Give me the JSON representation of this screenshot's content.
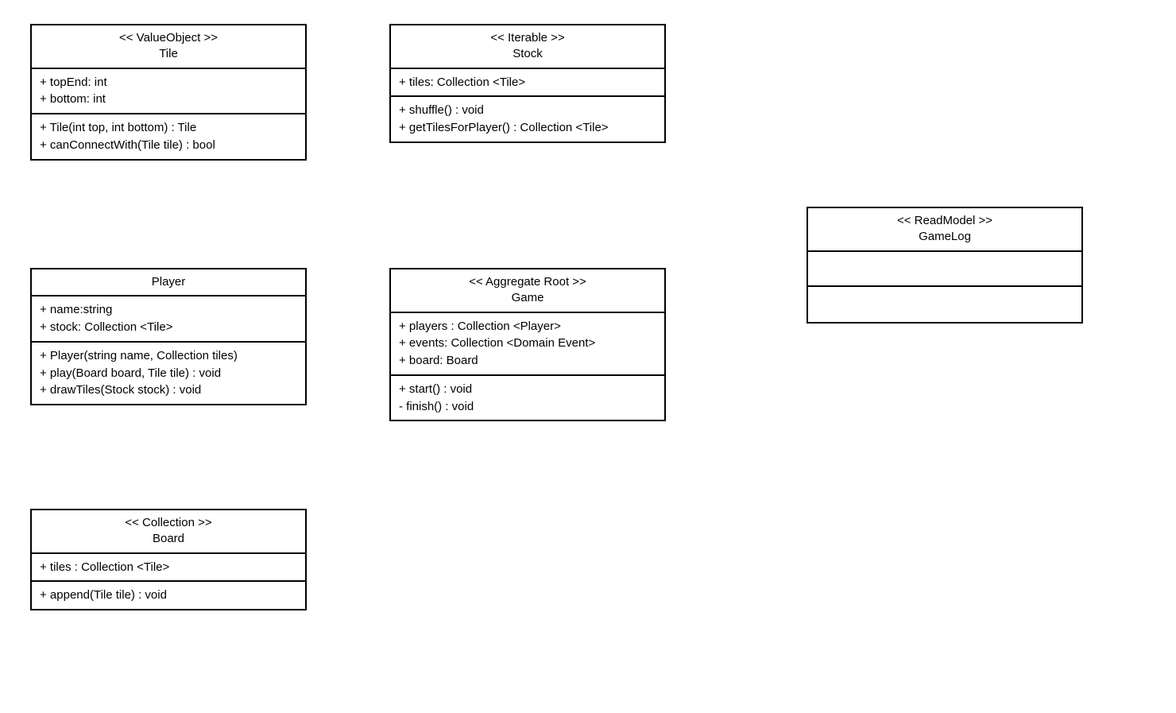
{
  "tile": {
    "stereo": "<< ValueObject >>",
    "name": "Tile",
    "attrs": [
      "+ topEnd: int",
      "+ bottom: int"
    ],
    "ops": [
      "+ Tile(int top, int bottom) : Tile",
      "+ canConnectWith(Tile tile) : bool"
    ]
  },
  "stock": {
    "stereo": "<< Iterable >>",
    "name": "Stock",
    "attrs": [
      "+ tiles: Collection <Tile>"
    ],
    "ops": [
      "+ shuffle() : void",
      "+ getTilesForPlayer() : Collection <Tile>"
    ]
  },
  "player": {
    "name": "Player",
    "attrs": [
      "+ name:string",
      "+ stock: Collection <Tile>"
    ],
    "ops": [
      "+ Player(string name, Collection tiles)",
      "+ play(Board board, Tile tile) : void",
      "+ drawTiles(Stock stock) : void"
    ]
  },
  "game": {
    "stereo": "<< Aggregate Root >>",
    "name": "Game",
    "attrs": [
      "+ players : Collection <Player>",
      "+ events: Collection <Domain Event>",
      "+ board: Board"
    ],
    "ops": [
      "+ start() : void",
      "- finish() : void"
    ]
  },
  "gamelog": {
    "stereo": "<< ReadModel >>",
    "name": "GameLog"
  },
  "board": {
    "stereo": "<< Collection >>",
    "name": "Board",
    "attrs": [
      "+ tiles : Collection <Tile>"
    ],
    "ops": [
      "+ append(Tile tile) : void"
    ]
  }
}
